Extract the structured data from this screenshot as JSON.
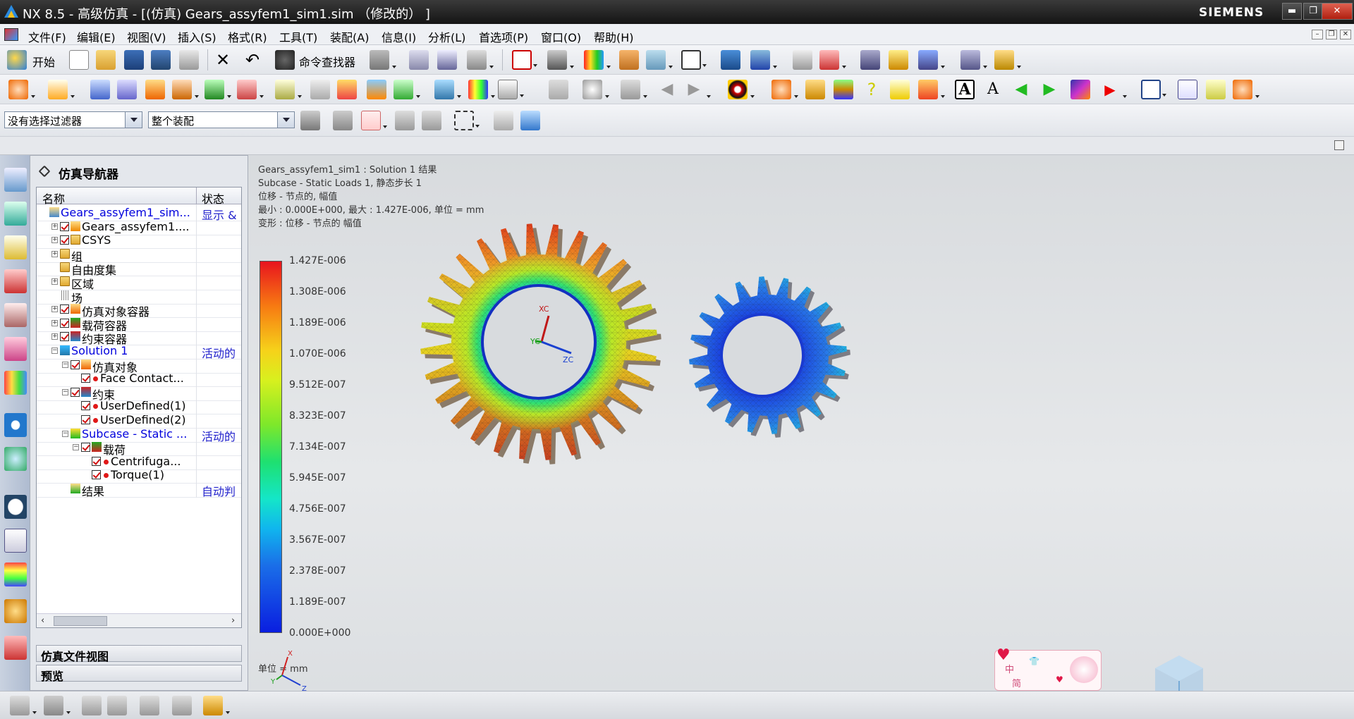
{
  "window": {
    "title": "NX 8.5 - 高级仿真 - [(仿真) Gears_assyfem1_sim1.sim （修改的） ]",
    "brand": "SIEMENS",
    "minimize": "▬",
    "restore": "❐",
    "close": "✕"
  },
  "menu": {
    "items": [
      "文件(F)",
      "编辑(E)",
      "视图(V)",
      "插入(S)",
      "格式(R)",
      "工具(T)",
      "装配(A)",
      "信息(I)",
      "分析(L)",
      "首选项(P)",
      "窗口(O)",
      "帮助(H)"
    ],
    "mdi": [
      "–",
      "❐",
      "✕"
    ]
  },
  "toolbar": {
    "start_label": "开始",
    "command_finder_label": "命令查找器",
    "selection_filter": "没有选择过滤器",
    "assembly_scope": "整个装配"
  },
  "navigator": {
    "title": "仿真导航器",
    "col_name": "名称",
    "col_state": "状态",
    "rows": [
      {
        "name": "Gears_assyfem1_sim...",
        "state": "显示 &"
      },
      {
        "name": "Gears_assyfem1....",
        "state": ""
      },
      {
        "name": "CSYS",
        "state": ""
      },
      {
        "name": "组",
        "state": ""
      },
      {
        "name": "自由度集",
        "state": ""
      },
      {
        "name": "区域",
        "state": ""
      },
      {
        "name": "场",
        "state": ""
      },
      {
        "name": "仿真对象容器",
        "state": ""
      },
      {
        "name": "载荷容器",
        "state": ""
      },
      {
        "name": "约束容器",
        "state": ""
      },
      {
        "name": "Solution 1",
        "state": "活动的"
      },
      {
        "name": "仿真对象",
        "state": ""
      },
      {
        "name": "Face Contact...",
        "state": ""
      },
      {
        "name": "约束",
        "state": ""
      },
      {
        "name": "UserDefined(1)",
        "state": ""
      },
      {
        "name": "UserDefined(2)",
        "state": ""
      },
      {
        "name": "Subcase - Static ...",
        "state": "活动的"
      },
      {
        "name": "载荷",
        "state": ""
      },
      {
        "name": "Centrifuga...",
        "state": ""
      },
      {
        "name": "Torque(1)",
        "state": ""
      },
      {
        "name": "结果",
        "state": "自动判"
      }
    ],
    "scroll_left": "‹",
    "scroll_right": "›",
    "section1": "仿真文件视图",
    "section2": "预览",
    "chevron": "⌄"
  },
  "viewport": {
    "info": [
      "Gears_assyfem1_sim1 : Solution 1 结果",
      "Subcase - Static Loads 1, 静态步长 1",
      "位移 - 节点的, 幅值",
      "最小 : 0.000E+000, 最大 : 1.427E-006, 单位 = mm",
      "变形 : 位移 - 节点的 幅值"
    ],
    "legend_values": [
      "1.427E-006",
      "1.308E-006",
      "1.189E-006",
      "1.070E-006",
      "9.512E-007",
      "8.323E-007",
      "7.134E-007",
      "5.945E-007",
      "4.756E-007",
      "3.567E-007",
      "2.378E-007",
      "1.189E-007",
      "0.000E+000"
    ],
    "unit": "单位 = mm",
    "axes": {
      "x": "XC",
      "y": "YC",
      "z": "ZC"
    },
    "triad": {
      "x": "X",
      "y": "Y",
      "z": "Z"
    },
    "ime_text": [
      "中",
      "简"
    ]
  }
}
